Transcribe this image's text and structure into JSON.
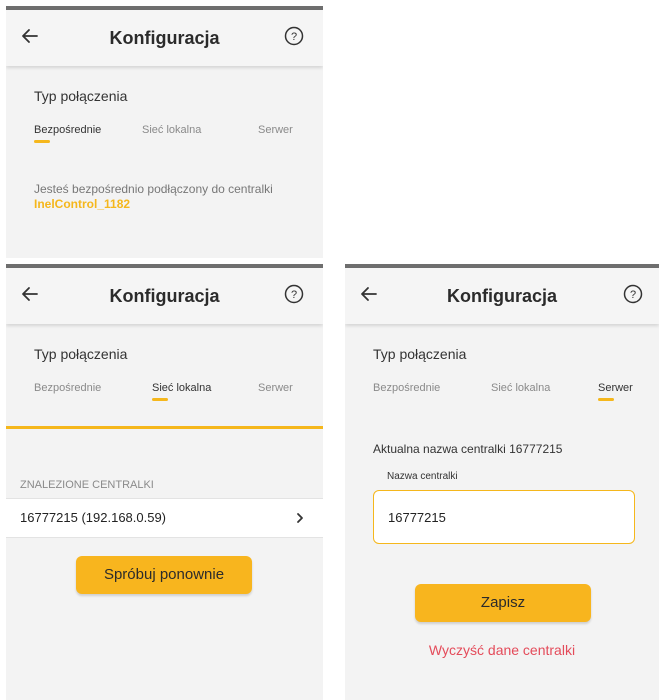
{
  "colors": {
    "accent": "#f5b71c",
    "button": "#f8b51e",
    "danger": "#e44b5a",
    "background": "#f3f3f3"
  },
  "screens": [
    {
      "header": {
        "title": "Konfiguracja",
        "back_icon": "arrow-left-icon",
        "help_icon": "help-circle-icon"
      },
      "section_label": "Typ połączenia",
      "tabs": [
        {
          "label": "Bezpośrednie",
          "active": true
        },
        {
          "label": "Sieć lokalna",
          "active": false
        },
        {
          "label": "Serwer",
          "active": false
        }
      ],
      "info_text": "Jesteś bezpośrednio podłączony do centralki",
      "device_name": "InelControl_1182"
    },
    {
      "header": {
        "title": "Konfiguracja"
      },
      "section_label": "Typ połączenia",
      "tabs": [
        {
          "label": "Bezpośrednie",
          "active": false
        },
        {
          "label": "Sieć lokalna",
          "active": true
        },
        {
          "label": "Serwer",
          "active": false
        }
      ],
      "found_header": "ZNALEZIONE CENTRALKI",
      "found_items": [
        {
          "label": "16777215 (192.168.0.59)"
        }
      ],
      "retry_label": "Spróbuj ponownie"
    },
    {
      "header": {
        "title": "Konfiguracja"
      },
      "section_label": "Typ połączenia",
      "tabs": [
        {
          "label": "Bezpośrednie",
          "active": false
        },
        {
          "label": "Sieć lokalna",
          "active": false
        },
        {
          "label": "Serwer",
          "active": true
        }
      ],
      "current_name_text": "Aktualna nazwa centralki 16777215",
      "field_label": "Nazwa centralki",
      "field_value": "16777215",
      "save_label": "Zapisz",
      "clear_label": "Wyczyść dane centralki"
    }
  ]
}
